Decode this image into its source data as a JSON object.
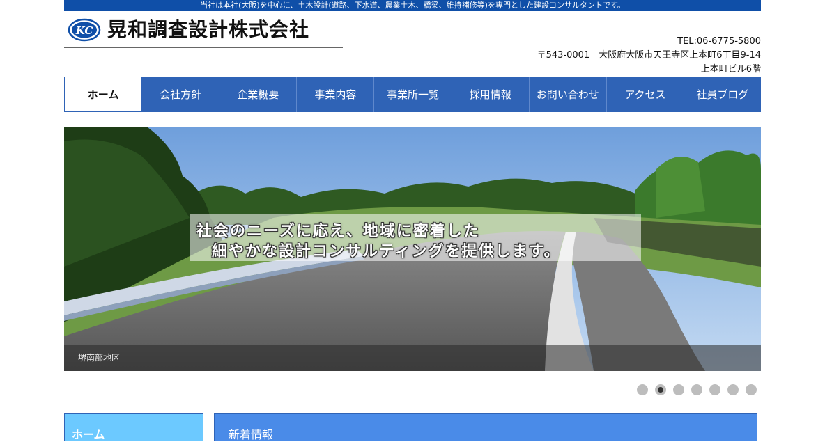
{
  "topbar": {
    "text": "当社は本社(大阪)を中心に、土木設計(道路、下水道、農業土木、橋梁、維持補修等)を専門とした建設コンサルタントです。"
  },
  "header": {
    "logo_mark": "KC",
    "company_name": "晃和調査設計株式会社",
    "tel": "TEL:06-6775-5800",
    "address_line1": "〒543-0001　大阪府大阪市天王寺区上本町6丁目9-14",
    "address_line2": "上本町ビル6階"
  },
  "nav": {
    "items": [
      {
        "label": "ホーム",
        "active": true
      },
      {
        "label": "会社方針"
      },
      {
        "label": "企業概要"
      },
      {
        "label": "事業内容"
      },
      {
        "label": "事業所一覧"
      },
      {
        "label": "採用情報"
      },
      {
        "label": "お問い合わせ"
      },
      {
        "label": "アクセス"
      },
      {
        "label": "社員ブログ"
      }
    ]
  },
  "slider": {
    "caption_line1": "社会のニーズに応え、地域に密着した",
    "caption_line2": "細やかな設計コンサルティングを提供します。",
    "slide_label": "堺南部地区",
    "dot_count": 7,
    "active_dot": 2
  },
  "sidebar": {
    "title": "ホーム"
  },
  "news": {
    "title": "新着情報"
  },
  "colors": {
    "brand_blue": "#0f4fa8",
    "nav_blue": "#2f63b6",
    "sidebar_blue": "#6cc9ff",
    "news_blue": "#4a8be8"
  }
}
